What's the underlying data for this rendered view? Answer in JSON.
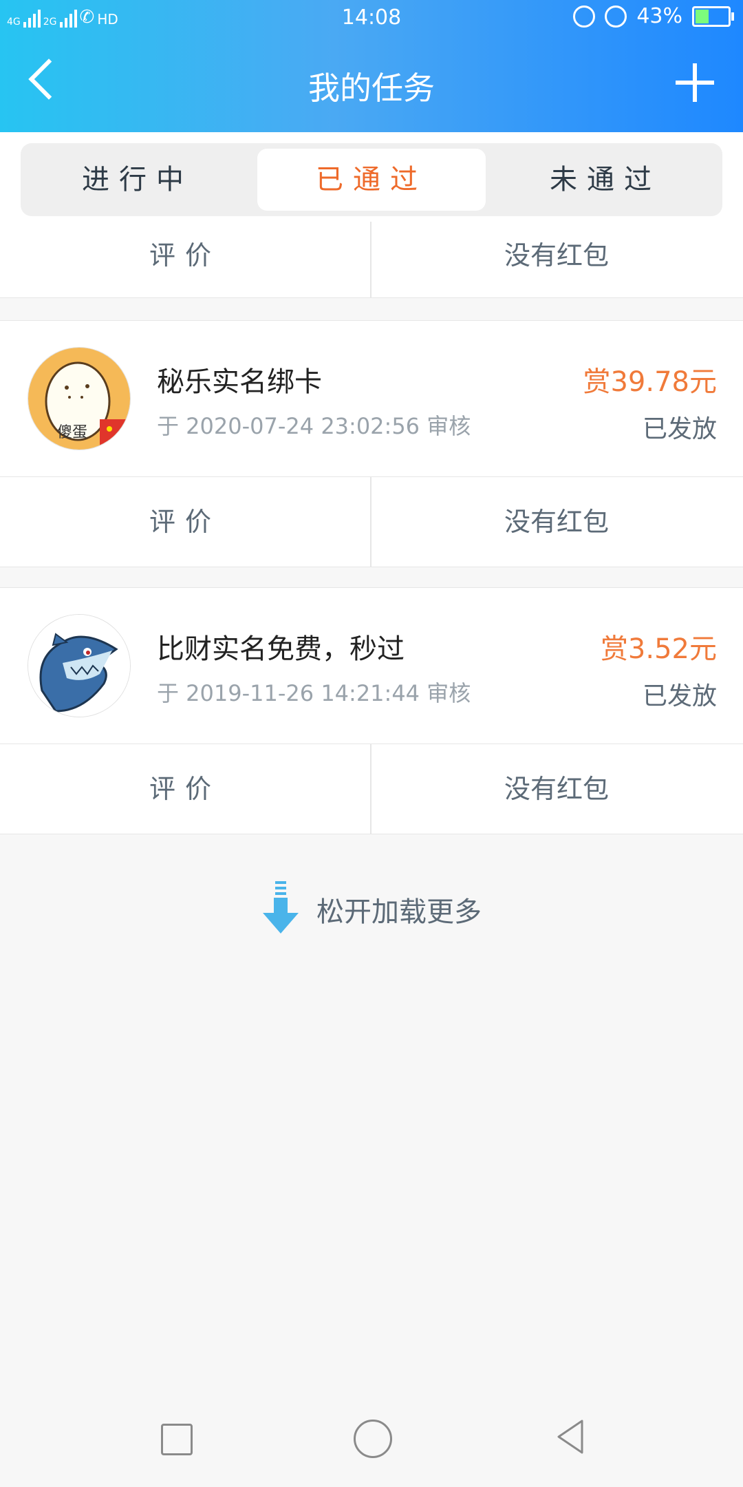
{
  "status_bar": {
    "network_1": "4G",
    "network_2": "2G",
    "hd": "HD",
    "time": "14:08",
    "battery_percent": "43%",
    "battery_level": 0.43
  },
  "nav": {
    "title": "我的任务",
    "back_icon": "chevron-left-icon",
    "add_icon": "plus-icon"
  },
  "tabs": [
    {
      "label": "进行中",
      "active": false
    },
    {
      "label": "已通过",
      "active": true
    },
    {
      "label": "未通过",
      "active": false
    }
  ],
  "partial_row": {
    "evaluate": "评价",
    "redpacket": "没有红包"
  },
  "tasks": [
    {
      "title": "秘乐实名绑卡",
      "date": "于 2020-07-24 23:02:56 审核",
      "reward": "赏39.78元",
      "status": "已发放",
      "evaluate": "评价",
      "redpacket": "没有红包",
      "avatar_icon": "egg-avatar-icon",
      "avatar_label": "傻蛋"
    },
    {
      "title": "比财实名免费，秒过",
      "date": "于 2019-11-26 14:21:44 审核",
      "reward": "赏3.52元",
      "status": "已发放",
      "evaluate": "评价",
      "redpacket": "没有红包",
      "avatar_icon": "shark-avatar-icon"
    }
  ],
  "load_more": {
    "text": "松开加载更多",
    "icon": "arrow-down-icon"
  },
  "colors": {
    "header_start": "#27c4f2",
    "header_end": "#1e88ff",
    "active_tab_text": "#ee6a2a",
    "reward": "#f07a3a"
  }
}
